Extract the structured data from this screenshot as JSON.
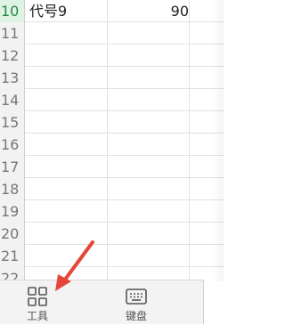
{
  "sheet": {
    "rows": [
      {
        "num": "10",
        "a": "代号9",
        "b": "90",
        "active": true
      },
      {
        "num": "11",
        "a": "",
        "b": ""
      },
      {
        "num": "12",
        "a": "",
        "b": ""
      },
      {
        "num": "13",
        "a": "",
        "b": ""
      },
      {
        "num": "14",
        "a": "",
        "b": ""
      },
      {
        "num": "15",
        "a": "",
        "b": ""
      },
      {
        "num": "16",
        "a": "",
        "b": ""
      },
      {
        "num": "17",
        "a": "",
        "b": ""
      },
      {
        "num": "18",
        "a": "",
        "b": ""
      },
      {
        "num": "19",
        "a": "",
        "b": ""
      },
      {
        "num": "20",
        "a": "",
        "b": ""
      },
      {
        "num": "21",
        "a": "",
        "b": ""
      },
      {
        "num": "22",
        "a": "",
        "b": ""
      }
    ]
  },
  "toolbar": {
    "tools_label": "工具",
    "tools_icon": "grid-icon",
    "keyboard_label": "键盘",
    "keyboard_icon": "keyboard-icon"
  },
  "annotation": {
    "icon": "red-arrow-icon",
    "color": "#e5463a"
  }
}
